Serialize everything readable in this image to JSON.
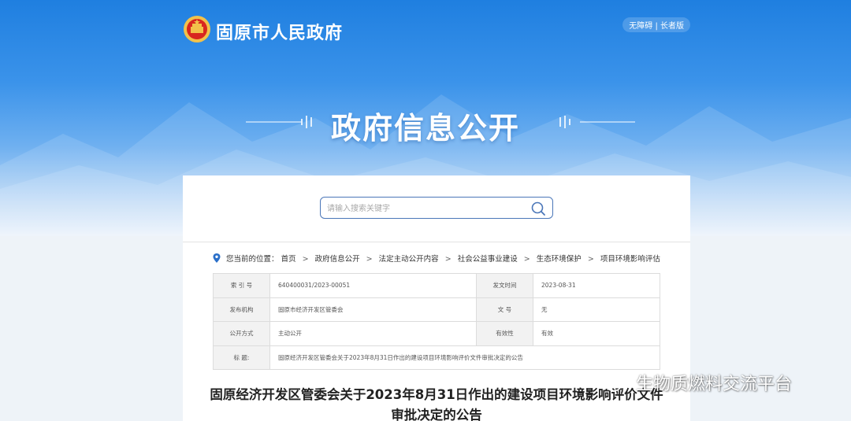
{
  "header": {
    "site_title": "固原市人民政府",
    "accessibility": "无障碍",
    "elder_mode": "长者版",
    "hero_title": "政府信息公开"
  },
  "search": {
    "placeholder": "请输入搜索关键字"
  },
  "breadcrumb": {
    "prefix": "您当前的位置：",
    "items": [
      "首页",
      "政府信息公开",
      "法定主动公开内容",
      "社会公益事业建设",
      "生态环境保护",
      "项目环境影响评估"
    ]
  },
  "meta": {
    "index_label": "索 引 号",
    "index_value": "640400031/2023-00051",
    "date_label": "发文时间",
    "date_value": "2023-08-31",
    "issuer_label": "发布机构",
    "issuer_value": "固原市经济开发区管委会",
    "doc_no_label": "文    号",
    "doc_no_value": "无",
    "method_label": "公开方式",
    "method_value": "主动公开",
    "validity_label": "有效性",
    "validity_value": "有效",
    "title_label": "标    题:",
    "title_value": "固原经济开发区管委会关于2023年8月31日作出的建设项目环境影响评价文件审批决定的公告"
  },
  "article": {
    "title": "固原经济开发区管委会关于2023年8月31日作出的建设项目环境影响评价文件审批决定的公告"
  },
  "watermark": {
    "text": "生物质燃料交流平台"
  },
  "colors": {
    "hero_top": "#1f7fe0",
    "accent": "#4a76b8",
    "emblem_red": "#d8261f",
    "emblem_gold": "#f2c14a"
  }
}
